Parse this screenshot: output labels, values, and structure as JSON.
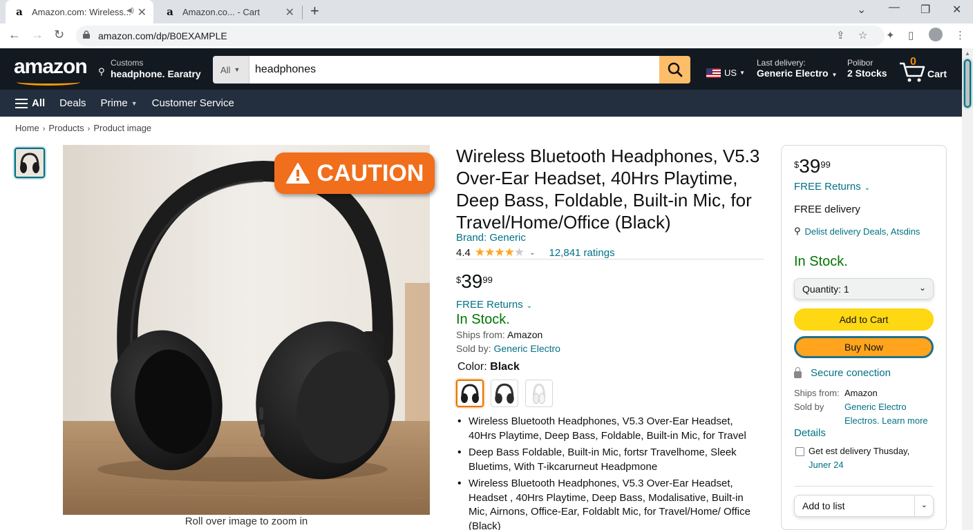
{
  "browser": {
    "tabs": [
      {
        "title": "Amazon.com: Wireless...",
        "active": true
      },
      {
        "title": "Amazon.co... - Cart",
        "active": false
      }
    ],
    "url": "amazon.com/dp/B0EXAMPLE"
  },
  "header": {
    "logo_text": "amazon",
    "deliver_line1": "Customs",
    "deliver_line2": "headphone. Earatry",
    "search_category": "All",
    "search_value": "headphones",
    "language": "US",
    "last_delivery_label": "Last delivery:",
    "last_delivery_value": "Generic Electro",
    "orders_label": "Polibor",
    "orders_value": "2 Stocks",
    "cart_count": "0",
    "cart_label": "Cart"
  },
  "subnav": {
    "items": [
      "All",
      "Deals",
      "Prime",
      "Customer Service"
    ]
  },
  "breadcrumb": [
    "Home",
    "Products",
    "Product image"
  ],
  "gallery": {
    "caution_label": "CAUTION",
    "zoom_hint": "Roll over image to zoom in"
  },
  "product": {
    "title": "Wireless Bluetooth Headphones, V5.3 Over-Ear Headset, 40Hrs Playtime, Deep Bass, Foldable, Built-in Mic, for Travel/Home/Office (Black)",
    "brand": "Brand: Generic",
    "rating": "4.4",
    "rating_stars": 4.4,
    "ratings_count": "12,841 ratings",
    "price_symbol": "$",
    "price_whole": "39",
    "price_fraction": "99",
    "free_returns": "FREE Returns",
    "in_stock": "In Stock.",
    "ships_from_label": "Ships from:",
    "ships_from_value": "Amazon",
    "sold_by_label": "Sold by:",
    "sold_by_value": "Generic Electro",
    "color_label": "Color:",
    "color_value": "Black",
    "bullets": [
      "Wireless Bluetooth Headphones, V5.3 Over-Ear Headset, 40Hrs Playtime, Deep Bass, Foldable, Built-in Mic, for Travel",
      "Deep Bass Foldable, Built-in Mic, fortsr Travelhome, Sleek Bluetims, With T-ikcarurneut Headpmone",
      "Wireless Bluetooth Headphones, V5.3 Over-Ear Headset, Headset , 40Hrs Playtime, Deep Bass, Modalisative, Built-in Mic, Airnons, Office-Ear, Foldablt Mic, for Travel/Home/ Office (Black)"
    ]
  },
  "buybox": {
    "price_symbol": "$",
    "price_whole": "39",
    "price_fraction": "99",
    "free_returns": "FREE Returns",
    "free_delivery": "FREE delivery",
    "location": "Delist delivery Deals, Atsdins",
    "in_stock": "In Stock.",
    "quantity": "Quantity: 1",
    "add_to_cart": "Add to Cart",
    "buy_now": "Buy Now",
    "secure": "Secure conection",
    "ships_from_label": "Ships from:",
    "ships_from_value": "Amazon",
    "sold_by_label": "Sold by",
    "sold_by_value1": "Generic Electro",
    "sold_by_value2": "Electros. Learn more",
    "details": "Details",
    "est_delivery": "Get est delivery Thusday,",
    "est_delivery_date": "Juner 24",
    "add_to_list": "Add to list"
  },
  "colors": {
    "accent_orange": "#ff9900",
    "header_bg": "#131921",
    "subnav_bg": "#232f3e",
    "link": "#007185",
    "in_stock": "#007600",
    "add_to_cart": "#ffd814",
    "buy_now": "#ffa41c",
    "caution": "#f06e1c"
  }
}
